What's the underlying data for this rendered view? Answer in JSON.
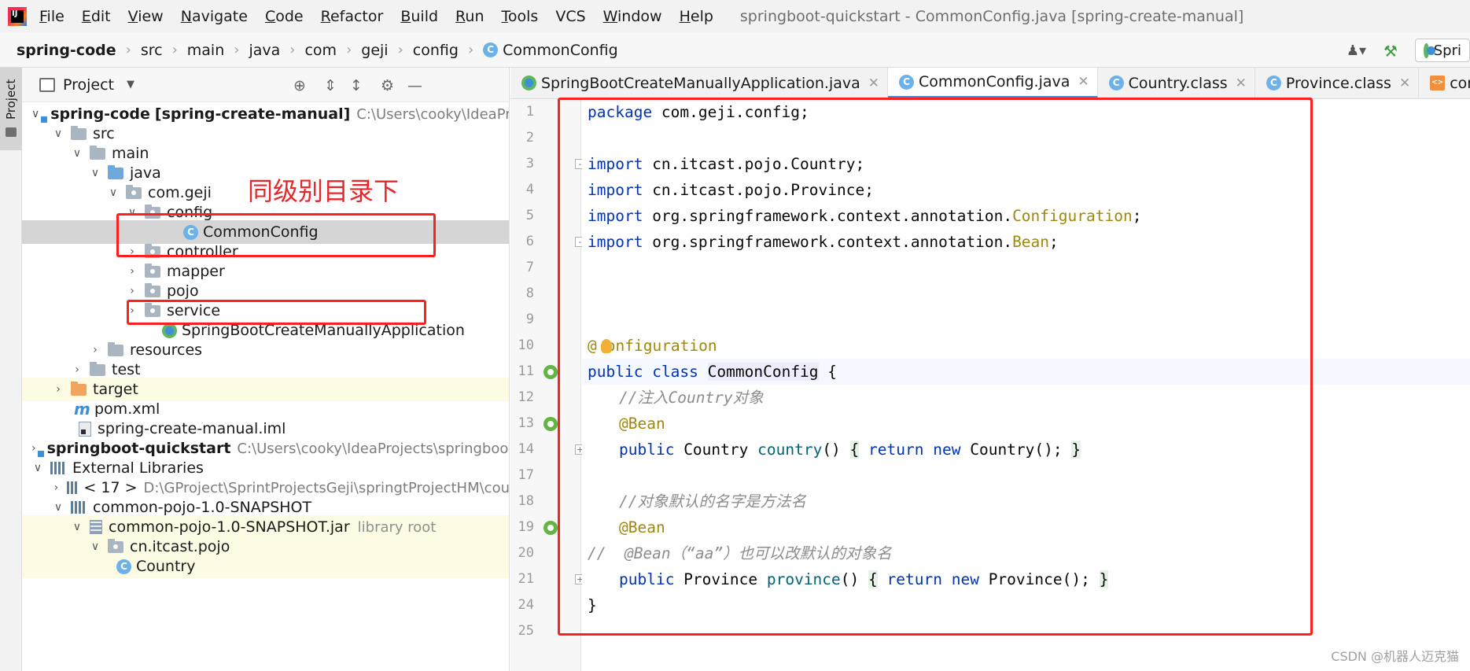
{
  "menubar": {
    "items": [
      {
        "label": "File",
        "underline": "F",
        "rest": "ile"
      },
      {
        "label": "Edit",
        "underline": "E",
        "rest": "dit"
      },
      {
        "label": "View",
        "underline": "V",
        "rest": "iew"
      },
      {
        "label": "Navigate",
        "underline": "N",
        "rest": "avigate"
      },
      {
        "label": "Code",
        "underline": "C",
        "rest": "ode"
      },
      {
        "label": "Refactor",
        "underline": "R",
        "rest": "efactor"
      },
      {
        "label": "Build",
        "underline": "B",
        "rest": "uild"
      },
      {
        "label": "Run",
        "underline": "R",
        "rest": "un"
      },
      {
        "label": "Tools",
        "underline": "T",
        "rest": "ools"
      },
      {
        "label": "VCS",
        "underline": "",
        "rest": "VCS"
      },
      {
        "label": "Window",
        "underline": "W",
        "rest": "indow"
      },
      {
        "label": "Help",
        "underline": "H",
        "rest": "elp"
      }
    ],
    "window_title": "springboot-quickstart - CommonConfig.java [spring-create-manual]"
  },
  "breadcrumb": {
    "items": [
      "spring-code",
      "src",
      "main",
      "java",
      "com",
      "geji",
      "config",
      "CommonConfig"
    ],
    "class_icon_letter": "C",
    "run_config_label": "Spri"
  },
  "project_panel": {
    "title": "Project",
    "tab_label": "Project"
  },
  "tree": {
    "root_name": "spring-code",
    "root_module": "[spring-create-manual]",
    "root_path": "C:\\Users\\cooky\\IdeaProjec",
    "src": "src",
    "main": "main",
    "java": "java",
    "com_geji": "com.geji",
    "config": "config",
    "common_config": "CommonConfig",
    "controller": "controller",
    "mapper": "mapper",
    "pojo": "pojo",
    "service": "service",
    "app_class": "SpringBootCreateManuallyApplication",
    "resources": "resources",
    "test": "test",
    "target": "target",
    "pom": "pom.xml",
    "iml": "spring-create-manual.iml",
    "quickstart_name": "springboot-quickstart",
    "quickstart_path": "C:\\Users\\cooky\\IdeaProjects\\springboot",
    "external_libraries": "External Libraries",
    "jdk": "< 17 >",
    "jdk_path": "D:\\GProject\\SprintProjectsGeji\\springtProjectHM\\cou",
    "common_pojo": "common-pojo-1.0-SNAPSHOT",
    "common_pojo_jar": "common-pojo-1.0-SNAPSHOT.jar",
    "library_root": "library root",
    "cn_itcast_pojo": "cn.itcast.pojo",
    "country": "Country"
  },
  "annotation": {
    "text": "同级别目录下",
    "color": "#e5262b"
  },
  "editor": {
    "tabs": [
      {
        "label": "SpringBootCreateManuallyApplication.java",
        "icon": "spring-class-icon",
        "active": false
      },
      {
        "label": "CommonConfig.java",
        "icon": "class-icon",
        "active": true
      },
      {
        "label": "Country.class",
        "icon": "class-icon",
        "active": false
      },
      {
        "label": "Province.class",
        "icon": "class-icon",
        "active": false
      },
      {
        "label": "common-po",
        "icon": "xml-tab-icon",
        "active": false
      }
    ],
    "line_numbers": [
      "1",
      "2",
      "3",
      "4",
      "5",
      "6",
      "7",
      "8",
      "9",
      "10",
      "11",
      "12",
      "13",
      "14",
      "17",
      "18",
      "19",
      "20",
      "21",
      "24",
      "25"
    ],
    "code": {
      "l1_kw": "package",
      "l1_rest": " com.geji.config;",
      "l3_kw": "import",
      "l3_rest": " cn.itcast.pojo.Country;",
      "l4_kw": "import",
      "l4_rest": " cn.itcast.pojo.Province;",
      "l5_kw": "import",
      "l5_rest": " org.springframework.context.annotation.",
      "l5_ann": "Configuration",
      "l5_end": ";",
      "l6_kw": "import",
      "l6_rest": " org.springframework.context.annotation.",
      "l6_ann": "Bean",
      "l6_end": ";",
      "l10_a": "@",
      "l10_b": "onfiguration",
      "l11_kw1": "public",
      "l11_kw2": "class",
      "l11_cls": "CommonConfig",
      "l11_end": " {",
      "l12_cmt": "//注入Country对象",
      "l13_ann": "@Bean",
      "l14_kw": "public",
      "l14_type": " Country ",
      "l14_fn": "country",
      "l14_paren": "()",
      "l14_ob": "{",
      "l14_kw2": "return",
      "l14_kw3": "new",
      "l14_body": " Country();",
      "l14_cb": "}",
      "l18_cmt": "//对象默认的名字是方法名",
      "l19_ann": "@Bean",
      "l20_cmt": "//  @Bean（“aa”）也可以改默认的对象名",
      "l21_kw": "public",
      "l21_type": " Province ",
      "l21_fn": "province",
      "l21_paren": "()",
      "l21_ob": "{",
      "l21_kw2": "return",
      "l21_kw3": "new",
      "l21_body": " Province();",
      "l21_cb": "}",
      "l24": "}"
    }
  },
  "watermark": "CSDN @机器人迈克猫",
  "colors": {
    "highlight_red": "#ff1f1f",
    "keyword": "#0033b3",
    "annotation": "#9e880d",
    "comment": "#8c8c8c",
    "accent_blue": "#3d8fd6"
  }
}
